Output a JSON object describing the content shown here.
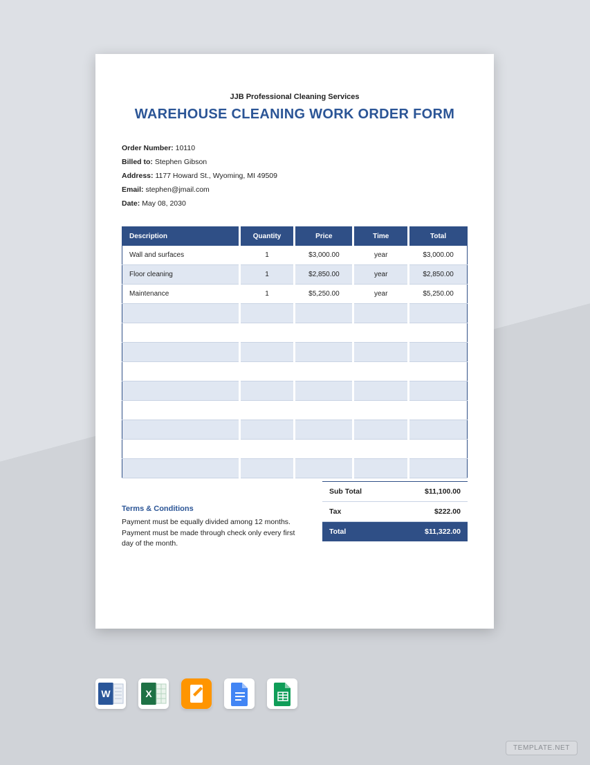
{
  "company": "JJB Professional Cleaning Services",
  "title": "WAREHOUSE CLEANING WORK ORDER FORM",
  "meta": {
    "order_label": "Order Number:",
    "order_value": "10110",
    "billed_label": "Billed to:",
    "billed_value": "Stephen Gibson",
    "address_label": "Address:",
    "address_value": "1177 Howard St., Wyoming, MI 49509",
    "email_label": "Email:",
    "email_value": "stephen@jmail.com",
    "date_label": "Date:",
    "date_value": "May 08, 2030"
  },
  "columns": {
    "desc": "Description",
    "qty": "Quantity",
    "price": "Price",
    "time": "Time",
    "total": "Total"
  },
  "rows": [
    {
      "desc": "Wall and surfaces",
      "qty": "1",
      "price": "$3,000.00",
      "time": "year",
      "total": "$3,000.00"
    },
    {
      "desc": "Floor cleaning",
      "qty": "1",
      "price": "$2,850.00",
      "time": "year",
      "total": "$2,850.00"
    },
    {
      "desc": "Maintenance",
      "qty": "1",
      "price": "$5,250.00",
      "time": "year",
      "total": "$5,250.00"
    }
  ],
  "empty_rows": 9,
  "totals": {
    "sub_label": "Sub Total",
    "sub_value": "$11,100.00",
    "tax_label": "Tax",
    "tax_value": "$222.00",
    "total_label": "Total",
    "total_value": "$11,322.00"
  },
  "terms": {
    "title": "Terms & Conditions",
    "line1": "Payment must be equally divided among 12 months.",
    "line2": "Payment must be made through check only every first day of the month."
  },
  "watermark": "TEMPLATE.NET"
}
